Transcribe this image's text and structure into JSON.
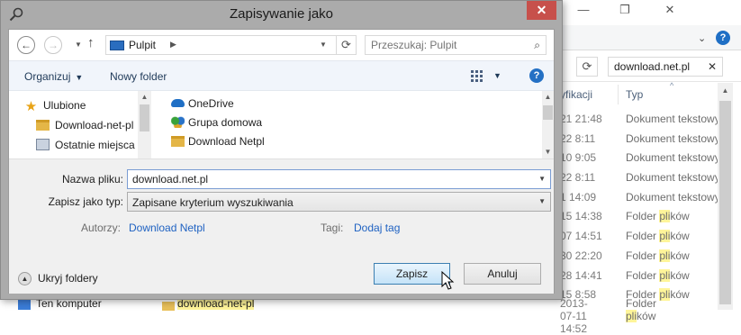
{
  "background_window": {
    "search_value": "download.net.pl",
    "column_modified_partial": "yfikacji",
    "column_type": "Typ",
    "rows": [
      {
        "date": "21 21:48",
        "type": "Dokument tekstowy",
        "highlight": ""
      },
      {
        "date": "22 8:11",
        "type": "Dokument tekstowy",
        "highlight": ""
      },
      {
        "date": "10 9:05",
        "type": "Dokument tekstowy",
        "highlight": ""
      },
      {
        "date": "22 8:11",
        "type": "Dokument tekstowy",
        "highlight": ""
      },
      {
        "date": "1 14:09",
        "type": "Dokument tekstowy",
        "highlight": ""
      },
      {
        "date": "15 14:38",
        "type_prefix": "Folder ",
        "type_hl": "pli",
        "type_suffix": "ków"
      },
      {
        "date": "07 14:51",
        "type_prefix": "Folder ",
        "type_hl": "pli",
        "type_suffix": "ków"
      },
      {
        "date": "30 22:20",
        "type_prefix": "Folder ",
        "type_hl": "pli",
        "type_suffix": "ków"
      },
      {
        "date": "28 14:41",
        "type_prefix": "Folder ",
        "type_hl": "pli",
        "type_suffix": "ków"
      },
      {
        "date": "15 8:58",
        "type_prefix": "Folder ",
        "type_hl": "pli",
        "type_suffix": "ków"
      }
    ],
    "bottom_row": {
      "left_label": "Ten komputer",
      "file_name": "download-net-pl",
      "date": "2013-07-11 14:52",
      "type_prefix": "Folder ",
      "type_hl": "pli",
      "type_suffix": "ków"
    }
  },
  "dialog": {
    "title": "Zapisywanie jako",
    "close_label": "✕",
    "address": {
      "location": "Pulpit"
    },
    "search": {
      "placeholder": "Przeszukaj: Pulpit"
    },
    "toolbar": {
      "organize": "Organizuj",
      "new_folder": "Nowy folder"
    },
    "tree_items": [
      {
        "label": "Ulubione",
        "icon": "star-icon"
      },
      {
        "label": "Download-net-pl",
        "icon": "folder-icon"
      },
      {
        "label": "Ostatnie miejsca",
        "icon": "recent-places-icon"
      }
    ],
    "file_items": [
      {
        "label": "OneDrive",
        "icon": "onedrive-icon"
      },
      {
        "label": "Grupa domowa",
        "icon": "homegroup-icon"
      },
      {
        "label": "Download Netpl",
        "icon": "folder-icon"
      }
    ],
    "form": {
      "filename_label": "Nazwa pliku:",
      "filename_value": "download.net.pl",
      "type_label": "Zapisz jako typ:",
      "type_value": "Zapisane kryterium wyszukiwania",
      "authors_label": "Autorzy:",
      "authors_value": "Download Netpl",
      "tags_label": "Tagi:",
      "tags_value": "Dodaj tag"
    },
    "hide_folders_label": "Ukryj foldery",
    "save_label": "Zapisz",
    "cancel_label": "Anuluj"
  },
  "colors": {
    "accent_blue": "#1f62c2",
    "close_red": "#c7504b",
    "search_highlight": "#fff59a",
    "dialog_frame": "#ababab"
  }
}
